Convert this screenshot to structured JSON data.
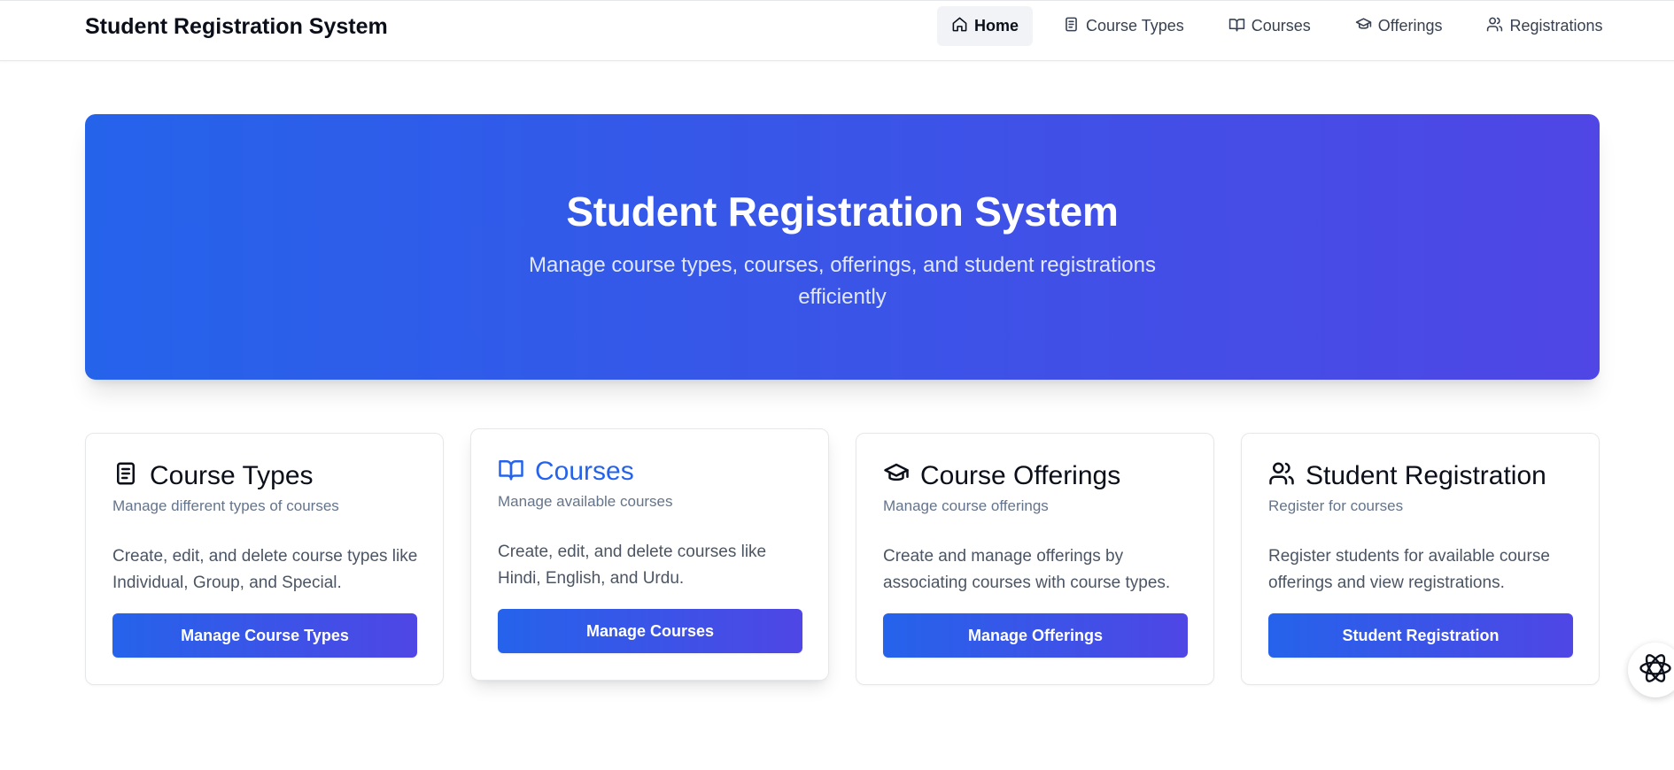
{
  "app": {
    "title": "Student Registration System"
  },
  "nav": {
    "items": [
      {
        "label": "Home",
        "icon": "home-icon",
        "active": true
      },
      {
        "label": "Course Types",
        "icon": "document-icon"
      },
      {
        "label": "Courses",
        "icon": "book-open-icon"
      },
      {
        "label": "Offerings",
        "icon": "graduation-cap-icon"
      },
      {
        "label": "Registrations",
        "icon": "users-icon"
      }
    ]
  },
  "hero": {
    "title": "Student Registration System",
    "subtitle": "Manage course types, courses, offerings, and student registrations efficiently"
  },
  "cards": [
    {
      "icon": "document-icon",
      "title": "Course Types",
      "subtitle": "Manage different types of courses",
      "description": "Create, edit, and delete course types like Individual, Group, and Special.",
      "button": "Manage Course Types"
    },
    {
      "icon": "book-open-icon",
      "title": "Courses",
      "subtitle": "Manage available courses",
      "description": "Create, edit, and delete courses like Hindi, English, and Urdu.",
      "button": "Manage Courses",
      "highlighted": true
    },
    {
      "icon": "graduation-cap-icon",
      "title": "Course Offerings",
      "subtitle": "Manage course offerings",
      "description": "Create and manage offerings by associating courses with course types.",
      "button": "Manage Offerings"
    },
    {
      "icon": "users-icon",
      "title": "Student Registration",
      "subtitle": "Register for courses",
      "description": "Register students for available course offerings and view registrations.",
      "button": "Student Registration"
    }
  ],
  "colors": {
    "accent_start": "#2563eb",
    "accent_end": "#4f46e5",
    "text_dark": "#0b0f19",
    "text_muted": "#64748b"
  },
  "floating": {
    "icon": "assistant-logo-icon"
  }
}
